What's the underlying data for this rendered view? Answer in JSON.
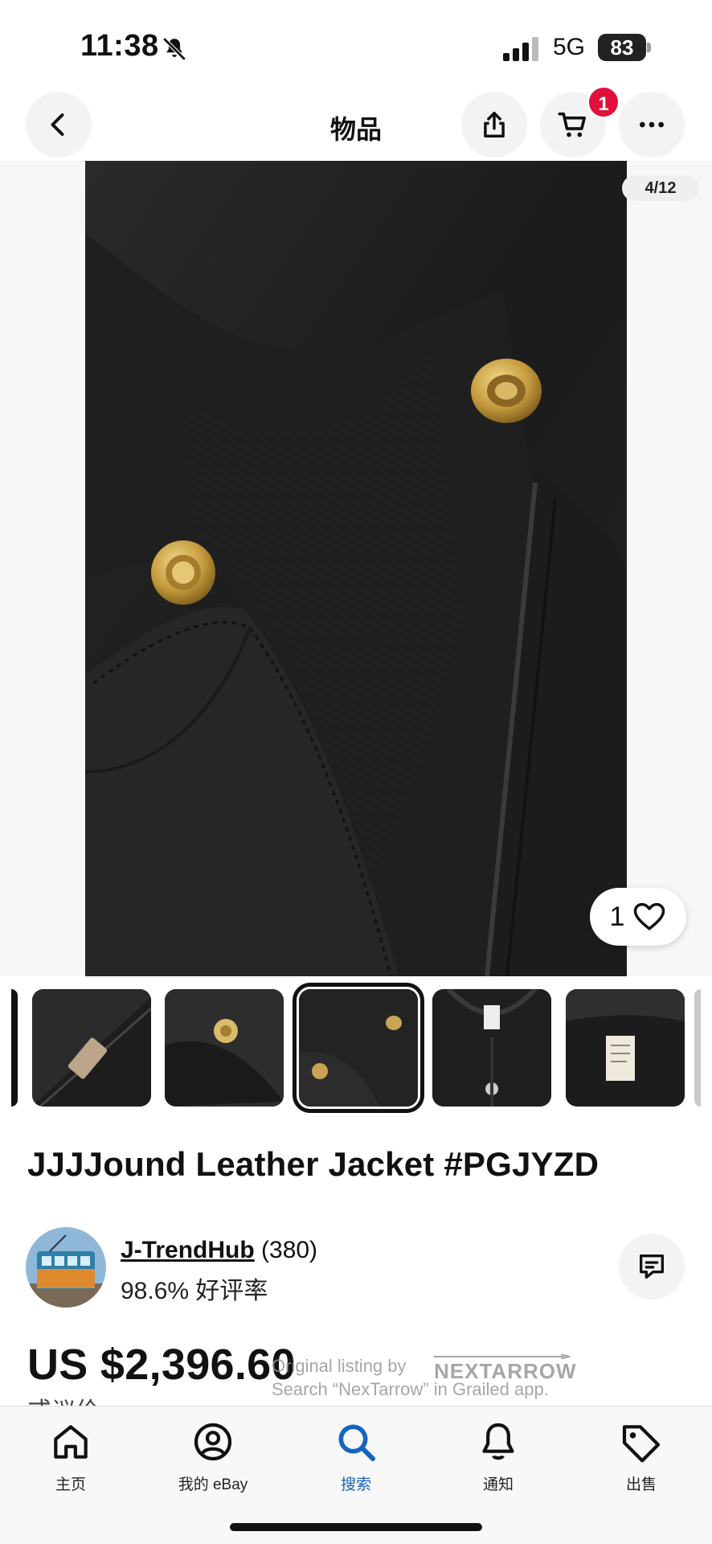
{
  "status_bar": {
    "time": "11:38",
    "network": "5G",
    "battery": "83",
    "icons": [
      "bell-slash-icon",
      "signal-icon",
      "battery-icon"
    ]
  },
  "nav": {
    "title": "物品",
    "cart_badge": "1",
    "icons": [
      "back-icon",
      "share-icon",
      "cart-icon",
      "more-icon"
    ]
  },
  "gallery": {
    "counter": "4/12",
    "like_count": "1",
    "thumbnail_count_visible": 5,
    "selected_thumbnail": 3
  },
  "item": {
    "title": "JJJJound Leather Jacket #PGJYZD"
  },
  "seller": {
    "name": "J-TrendHub",
    "count": "(380)",
    "rating": "98.6% 好评率"
  },
  "price": {
    "amount": "US $2,396.60",
    "sub": "或议价"
  },
  "watermark": {
    "line1": "Original listing by",
    "line2": "Search “NexTarrow” in Grailed app.",
    "brand": "NEXTARROW"
  },
  "tabs": [
    {
      "label": "主页",
      "icon": "home-icon"
    },
    {
      "label": "我的 eBay",
      "icon": "user-icon"
    },
    {
      "label": "搜索",
      "icon": "search-icon"
    },
    {
      "label": "通知",
      "icon": "bell-icon"
    },
    {
      "label": "出售",
      "icon": "tag-icon"
    }
  ],
  "colors": {
    "accent": "#1565c0",
    "badge": "#e0103a",
    "text": "#111111"
  }
}
